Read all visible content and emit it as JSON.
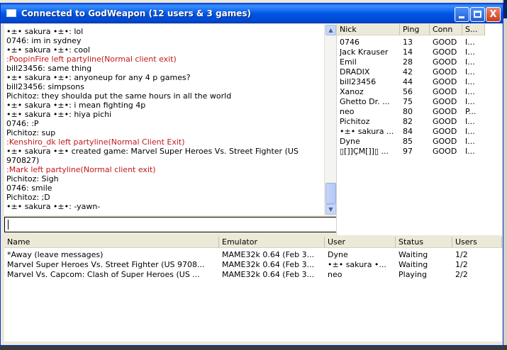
{
  "window": {
    "title": "Connected to GodWeapon (12 users & 3 games)",
    "close_glyph": "X"
  },
  "chat": {
    "lines": [
      {
        "text": "•±• sakura •±•: lol",
        "type": "normal"
      },
      {
        "text": "0746: im in sydney",
        "type": "normal"
      },
      {
        "text": "•±• sakura •±•: cool",
        "type": "normal"
      },
      {
        "text": ":PoopinFire left partyline(Normal client exit)",
        "type": "system"
      },
      {
        "text": "bill23456: same thing",
        "type": "normal"
      },
      {
        "text": "•±• sakura •±•: anyoneup for any 4 p games?",
        "type": "normal"
      },
      {
        "text": "bill23456: simpsons",
        "type": "normal"
      },
      {
        "text": "Pichitoz: they shoulda  put the same hours in all the world",
        "type": "normal"
      },
      {
        "text": "•±• sakura •±•: i mean fighting 4p",
        "type": "normal"
      },
      {
        "text": "•±• sakura •±•: hiya pichi",
        "type": "normal"
      },
      {
        "text": "0746: :P",
        "type": "normal"
      },
      {
        "text": "Pichitoz: sup",
        "type": "normal"
      },
      {
        "text": ":Kenshiro_dk left partyline(Normal Client Exit)",
        "type": "system"
      },
      {
        "text": "•±• sakura •±• created game: Marvel Super Heroes Vs. Street Fighter (US",
        "type": "normal"
      },
      {
        "text": "970827)",
        "type": "normal"
      },
      {
        "text": ":Mark left partyline(Normal client exit)",
        "type": "system"
      },
      {
        "text": "Pichitoz: Sigh",
        "type": "normal"
      },
      {
        "text": "0746: smile",
        "type": "normal"
      },
      {
        "text": "Pichitoz: ;D",
        "type": "normal"
      },
      {
        "text": "•±• sakura •±•: -yawn-",
        "type": "normal"
      }
    ],
    "input_value": ""
  },
  "users": {
    "columns": [
      "Nick",
      "Ping",
      "Conn",
      "S..."
    ],
    "rows": [
      [
        "0746",
        "13",
        "GOOD",
        "I..."
      ],
      [
        "Jack Krauser",
        "14",
        "GOOD",
        "I..."
      ],
      [
        "Emil",
        "28",
        "GOOD",
        "I..."
      ],
      [
        "DRADIX",
        "42",
        "GOOD",
        "I..."
      ],
      [
        "bill23456",
        "44",
        "GOOD",
        "I..."
      ],
      [
        "Xanoz",
        "56",
        "GOOD",
        "I..."
      ],
      [
        "Ghetto Dr. ...",
        "75",
        "GOOD",
        "I..."
      ],
      [
        "neo",
        "80",
        "GOOD",
        "P..."
      ],
      [
        "Pichitoz",
        "82",
        "GOOD",
        "I..."
      ],
      [
        "•±• sakura ...",
        "84",
        "GOOD",
        "I..."
      ],
      [
        "Dyne",
        "85",
        "GOOD",
        "I..."
      ],
      [
        "▯[]]ÇM[]]▯ ...",
        "97",
        "GOOD",
        "I..."
      ]
    ]
  },
  "games": {
    "columns": [
      "Name",
      "Emulator",
      "User",
      "Status",
      "Users"
    ],
    "rows": [
      [
        "*Away (leave messages)",
        "MAME32k 0.64 (Feb  3...",
        "Dyne",
        "Waiting",
        "1/2"
      ],
      [
        "Marvel Super Heroes Vs. Street Fighter (US 9708...",
        "MAME32k 0.64 (Feb  3...",
        "•±• sakura •...",
        "Waiting",
        "1/2"
      ],
      [
        "Marvel Vs. Capcom: Clash of Super Heroes (US ...",
        "MAME32k 0.64 (Feb  3...",
        "neo",
        "Playing",
        "2/2"
      ]
    ]
  },
  "colors": {
    "titlebar": "#0058e6",
    "system_message": "#c0181c",
    "window_face": "#ece9d8"
  }
}
